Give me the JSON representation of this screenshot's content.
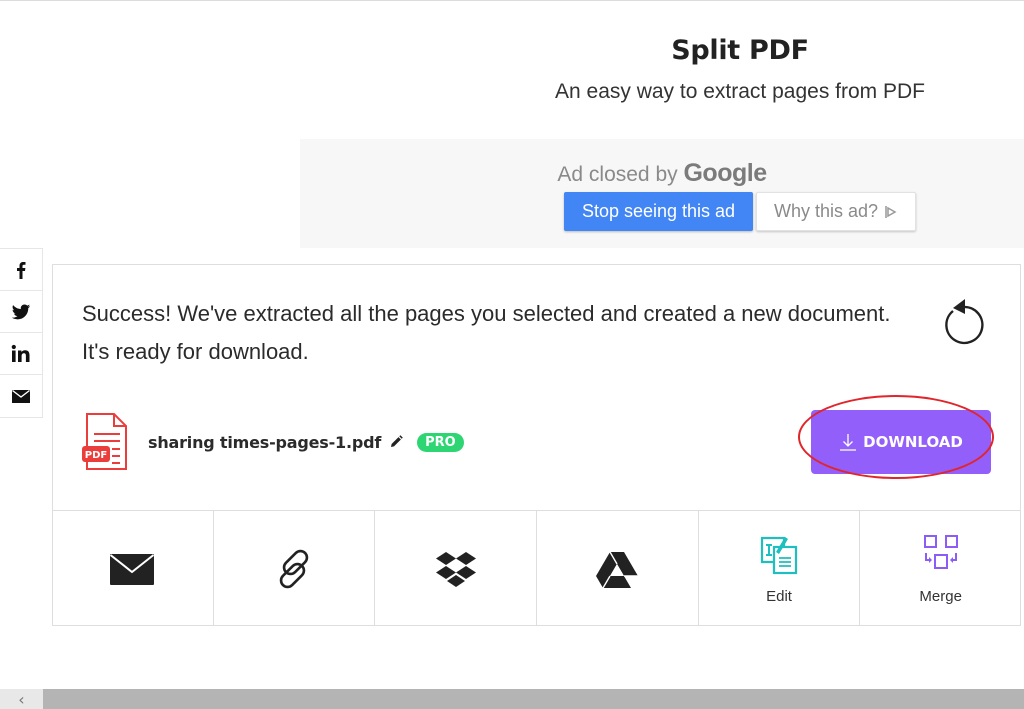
{
  "header": {
    "title": "Split PDF",
    "subtitle": "An easy way to extract pages from PDF"
  },
  "ad": {
    "closed_prefix": "Ad closed by",
    "closed_brand": "Google",
    "stop_label": "Stop seeing this ad",
    "why_label": "Why this ad?",
    "stop_color": "#4285f4"
  },
  "social": {
    "items": [
      {
        "icon": "facebook-icon"
      },
      {
        "icon": "twitter-icon"
      },
      {
        "icon": "linkedin-icon"
      },
      {
        "icon": "email-icon"
      }
    ]
  },
  "result": {
    "message": "Success! We've extracted all the pages you selected and created a new document. It's ready for download.",
    "file_name": "sharing times-pages-1.pdf",
    "badge": "PRO",
    "pdf_icon_label": "PDF",
    "download_label": "DOWNLOAD",
    "download_color": "#935ffb",
    "badge_color": "#2ed573"
  },
  "actions": [
    {
      "id": "email",
      "label": ""
    },
    {
      "id": "link",
      "label": ""
    },
    {
      "id": "dropbox",
      "label": ""
    },
    {
      "id": "google-drive",
      "label": ""
    },
    {
      "id": "edit",
      "label": "Edit"
    },
    {
      "id": "merge",
      "label": "Merge"
    }
  ],
  "scrollbar": {
    "left_arrow": "‹"
  }
}
